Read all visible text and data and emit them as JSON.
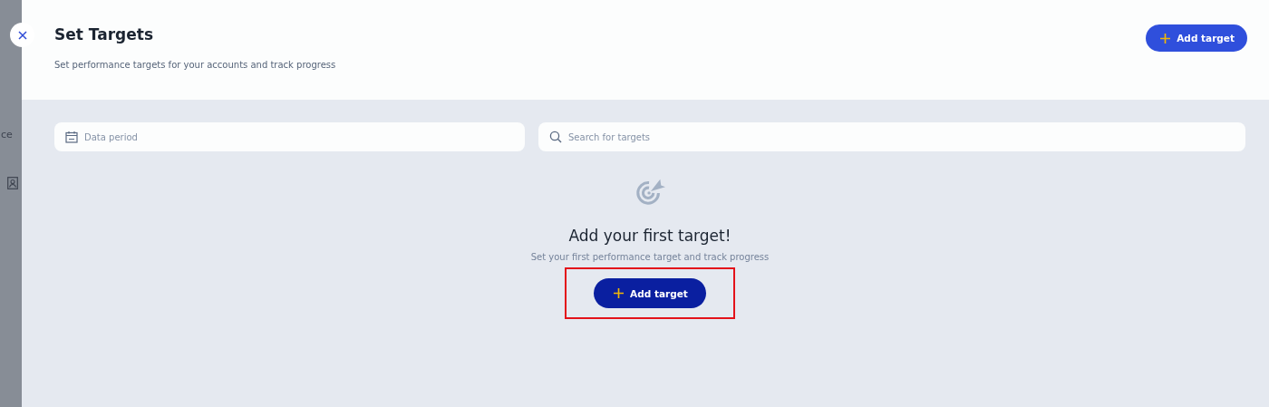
{
  "backdrop": {
    "text": "ce"
  },
  "panel": {
    "title": "Set Targets",
    "subtitle": "Set performance targets for your accounts and track progress",
    "header_button": "Add target"
  },
  "filters": {
    "period_placeholder": "Data period",
    "search_placeholder": "Search for targets"
  },
  "empty_state": {
    "heading": "Add your first target!",
    "text": "Set your first performance target and track progress",
    "button": "Add target",
    "highlighted": true
  }
}
